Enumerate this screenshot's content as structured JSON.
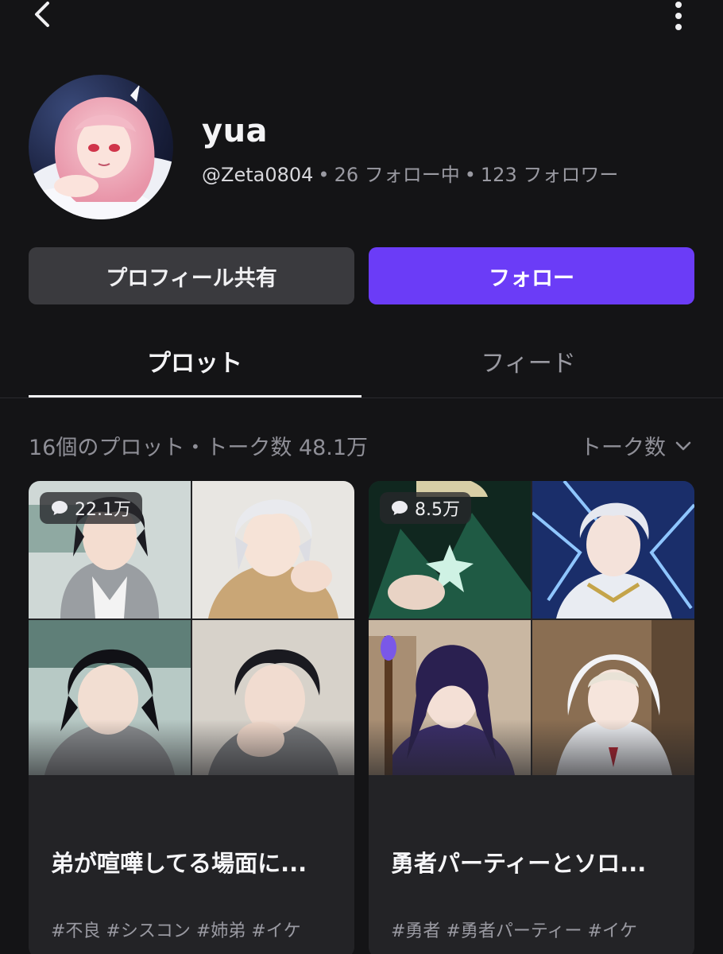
{
  "header": {
    "back_icon": "chevron-left-icon",
    "more_icon": "vertical-dots-icon"
  },
  "profile": {
    "name": "yua",
    "handle": "@Zeta0804",
    "following_count": "26",
    "following_label": "フォロー中",
    "followers_count": "123",
    "followers_label": "フォロワー"
  },
  "actions": {
    "share_label": "プロフィール共有",
    "follow_label": "フォロー",
    "follow_color": "#6b3cf7"
  },
  "tabs": [
    {
      "label": "プロット",
      "active": true
    },
    {
      "label": "フィード",
      "active": false
    }
  ],
  "summary": {
    "text": "16個のプロット・トーク数 48.1万",
    "sort_label": "トーク数"
  },
  "cards": [
    {
      "talk_count": "22.1万",
      "title": "弟が喧嘩してる場面に...",
      "tags": "#不良 #シスコン #姉弟 #イケ"
    },
    {
      "talk_count": "8.5万",
      "title": "勇者パーティーとソロ...",
      "tags": "#勇者 #勇者パーティー #イケ"
    }
  ]
}
